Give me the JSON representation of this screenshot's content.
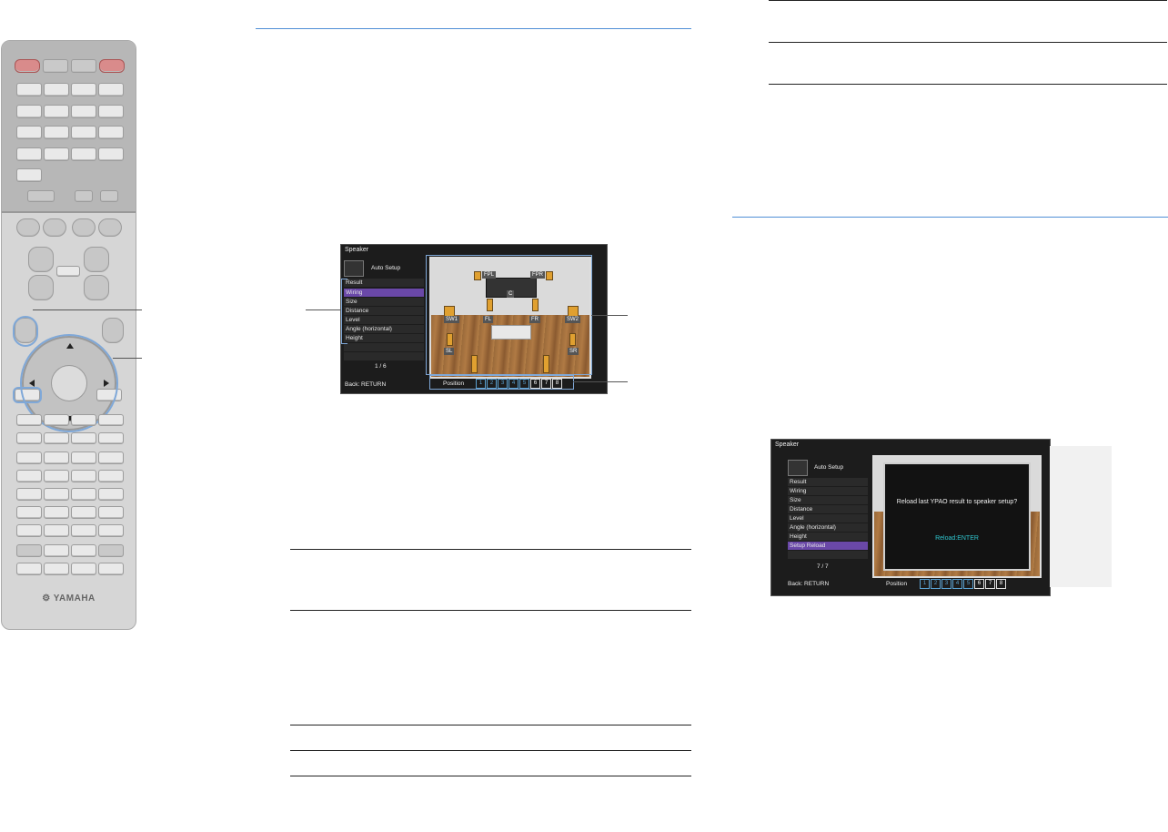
{
  "remote": {
    "brand": "YAMAHA"
  },
  "screen1": {
    "title": "Speaker",
    "mode": "Auto Setup",
    "menu": [
      "Result",
      "Wiring",
      "Size",
      "Distance",
      "Level",
      "Angle (horizontal)",
      "Height"
    ],
    "selected_index": 1,
    "page": "1 / 6",
    "back": "Back: RETURN",
    "position_label": "Position",
    "positions": [
      "1",
      "2",
      "3",
      "4",
      "5",
      "6",
      "7",
      "8"
    ],
    "speakers": [
      "FPL",
      "FPR",
      "C",
      "SW1",
      "FL",
      "FR",
      "SW2",
      "SL",
      "SR"
    ]
  },
  "screen2": {
    "title": "Speaker",
    "mode": "Auto Setup",
    "menu": [
      "Result",
      "Wiring",
      "Size",
      "Distance",
      "Level",
      "Angle (horizontal)",
      "Height",
      "Setup Reload"
    ],
    "selected_index": 7,
    "page": "7 / 7",
    "back": "Back: RETURN",
    "position_label": "Position",
    "positions": [
      "1",
      "2",
      "3",
      "4",
      "5",
      "6",
      "7",
      "8"
    ],
    "dialog_message": "Reload last YPAO result to speaker setup?",
    "dialog_action": "Reload:ENTER"
  },
  "colors": {
    "accent_rule": "#4f8fd6",
    "selected_item": "#6a48a8",
    "position_num": "#5aa0d0",
    "dialog_action": "#2fc6cf"
  }
}
